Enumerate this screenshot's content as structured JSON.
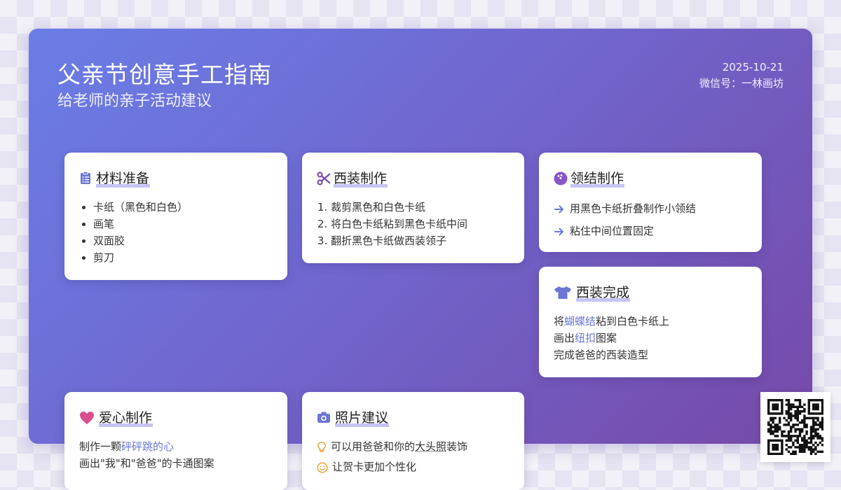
{
  "header": {
    "title": "父亲节创意手工指南",
    "subtitle": "给老师的亲子活动建议",
    "date": "2025-10-21",
    "wechat": "微信号：一林画坊"
  },
  "cards": {
    "materials": {
      "title": "材料准备",
      "icon": "clipboard-list-icon",
      "items": [
        "卡纸（黑色和白色）",
        "画笔",
        "双面胶",
        "剪刀"
      ]
    },
    "suit": {
      "title": "西装制作",
      "icon": "scissors-icon",
      "steps": [
        "裁剪黑色和白色卡纸",
        "将白色卡纸粘到黑色卡纸中间",
        "翻折黑色卡纸做西装领子"
      ]
    },
    "tie": {
      "title": "领结制作",
      "icon": "bowling-ball-icon",
      "items": [
        "用黑色卡纸折叠制作小领结",
        "粘住中间位置固定"
      ]
    },
    "finish": {
      "title": "西装完成",
      "icon": "tshirt-icon",
      "line1_pre": "将",
      "line1_hl": "蝴蝶结",
      "line1_post": "粘到白色卡纸上",
      "line2_pre": "画出",
      "line2_hl": "纽扣",
      "line2_post": "图案",
      "line3": "完成爸爸的西装造型"
    },
    "heart": {
      "title": "爱心制作",
      "icon": "heart-icon",
      "line1_pre": "制作一颗",
      "line1_hl": "砰砰跳的心",
      "line2": "画出\"我\"和\"爸爸\"的卡通图案"
    },
    "photo": {
      "title": "照片建议",
      "icon": "camera-icon",
      "line1_pre": "可以用爸爸和你的",
      "line1_ul": "大头照",
      "line1_post": "装饰",
      "line2": "让贺卡更加个性化"
    }
  },
  "colors": {
    "accent": "#6b76d6",
    "icon_blue": "#6b76d6",
    "icon_purple": "#7a4fb0",
    "heart_pink": "#d94d8f",
    "bulb_orange": "#e9a23b"
  }
}
